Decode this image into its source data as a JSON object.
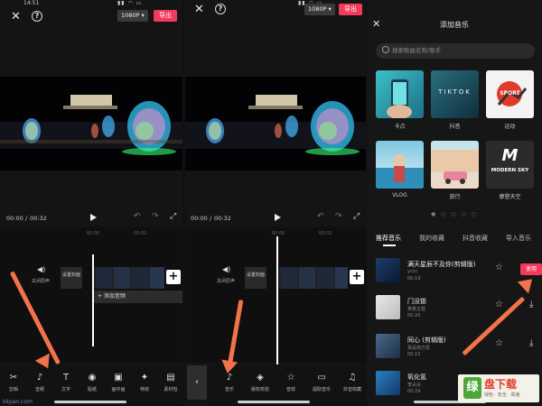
{
  "panel1": {
    "status_time": "14:51",
    "resolution": "1080P",
    "export_label": "导出",
    "time_current": "00:00",
    "time_sep": "/",
    "time_total": "00:32",
    "ruler": [
      "00:00",
      "00:02"
    ],
    "mute_label": "关闭原声",
    "cover_label": "设置封面",
    "add_audio_label": "+ 添加音频",
    "tools": [
      {
        "icon": "✂",
        "label": "剪辑"
      },
      {
        "icon": "♪",
        "label": "音频"
      },
      {
        "icon": "T",
        "label": "文字"
      },
      {
        "icon": "◉",
        "label": "贴纸"
      },
      {
        "icon": "▣",
        "label": "画中画"
      },
      {
        "icon": "✦",
        "label": "特效"
      },
      {
        "icon": "▤",
        "label": "素材包"
      }
    ]
  },
  "panel2": {
    "resolution": "1080P",
    "export_label": "导出",
    "time_current": "00:00",
    "time_sep": "/",
    "time_total": "00:32",
    "ruler": [
      "00:00",
      "00:02"
    ],
    "mute_label": "关闭原声",
    "cover_label": "设置封面",
    "tools": [
      {
        "icon": "♪",
        "label": "音乐"
      },
      {
        "icon": "◈",
        "label": "版权校验"
      },
      {
        "icon": "☆",
        "label": "音效"
      },
      {
        "icon": "▭",
        "label": "提取音乐"
      },
      {
        "icon": "♫",
        "label": "抖音收藏"
      }
    ]
  },
  "panel3": {
    "title": "添加音乐",
    "search_placeholder": "搜索歌曲名称/歌手",
    "categories": [
      {
        "label": "卡点",
        "overlay": ""
      },
      {
        "label": "抖音",
        "overlay": "TIKTOK"
      },
      {
        "label": "运动",
        "overlay": "SPORT"
      },
      {
        "label": "VLOG",
        "overlay": ""
      },
      {
        "label": "旅行",
        "overlay": ""
      },
      {
        "label": "摩登天空",
        "overlay": "MODERN SKY"
      }
    ],
    "dots": "● ○ ○ ○ ○",
    "tabs": [
      "推荐音乐",
      "我的收藏",
      "抖音收藏",
      "导入音乐"
    ],
    "songs": [
      {
        "title": "满天星辰不及你(剪辑版)",
        "artist": "yccc",
        "duration": "00:19",
        "action": "使用"
      },
      {
        "title": "门没锁",
        "artist": "黄惠主题",
        "duration": "00:20",
        "action": ""
      },
      {
        "title": "同心 (剪辑版)",
        "artist": "我是南方凯",
        "duration": "00:15",
        "action": ""
      },
      {
        "title": "氧化氢",
        "artist": "李尖尖",
        "duration": "00:29",
        "action": ""
      }
    ]
  },
  "watermark": "kkpan.com",
  "brand": {
    "logo": "绿",
    "name": "盘下载",
    "slogan": "绿色 · 安全 · 高速"
  },
  "colors": {
    "accent": "#f23a5b",
    "arrow": "#f2724a",
    "background": "#141414"
  }
}
